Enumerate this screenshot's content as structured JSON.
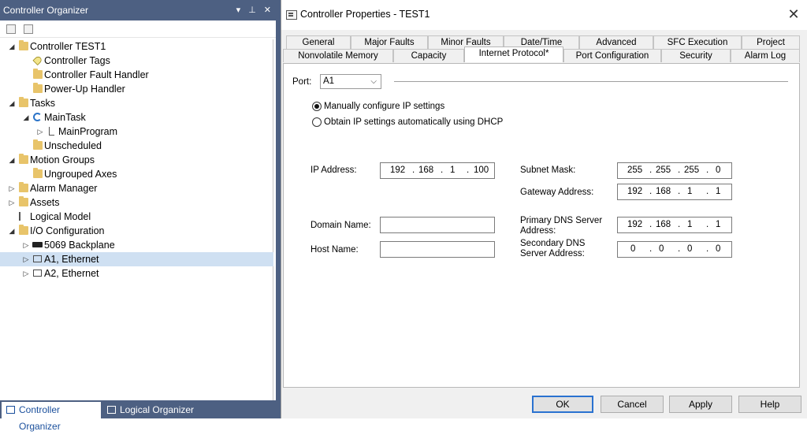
{
  "organizer": {
    "title": "Controller Organizer",
    "title_controls": [
      "▾",
      "⊥",
      "✕"
    ],
    "tree": [
      {
        "label": "Controller TEST1"
      },
      {
        "label": "Controller Tags"
      },
      {
        "label": "Controller Fault Handler"
      },
      {
        "label": "Power-Up Handler"
      },
      {
        "label": "Tasks"
      },
      {
        "label": "MainTask"
      },
      {
        "label": "MainProgram"
      },
      {
        "label": "Unscheduled"
      },
      {
        "label": "Motion Groups"
      },
      {
        "label": "Ungrouped Axes"
      },
      {
        "label": "Alarm Manager"
      },
      {
        "label": "Assets"
      },
      {
        "label": "Logical Model"
      },
      {
        "label": "I/O Configuration"
      },
      {
        "label": "5069 Backplane"
      },
      {
        "label": "A1, Ethernet"
      },
      {
        "label": "A2, Ethernet"
      }
    ],
    "bottom_tabs": [
      "Controller Organizer",
      "Logical Organizer"
    ]
  },
  "dialog": {
    "title": "Controller Properties - TEST1",
    "close": "✕",
    "tabs_row1": [
      "General",
      "Major Faults",
      "Minor Faults",
      "Date/Time",
      "Advanced",
      "SFC Execution",
      "Project"
    ],
    "tabs_row2": [
      "Nonvolatile Memory",
      "Capacity",
      "Internet Protocol*",
      "Port Configuration",
      "Security",
      "Alarm Log"
    ],
    "active_tab": "Internet Protocol*",
    "port": {
      "label": "Port:",
      "value": "A1",
      "chevron": "⌵"
    },
    "radios": [
      {
        "label": "Manually configure IP settings",
        "checked": true
      },
      {
        "label": "Obtain IP settings automatically using DHCP",
        "checked": false
      }
    ],
    "fields": {
      "ip_address": {
        "label": "IP Address:",
        "octets": [
          "192",
          "168",
          "1",
          "100"
        ]
      },
      "subnet_mask": {
        "label": "Subnet Mask:",
        "octets": [
          "255",
          "255",
          "255",
          "0"
        ]
      },
      "gateway": {
        "label": "Gateway Address:",
        "octets": [
          "192",
          "168",
          "1",
          "1"
        ]
      },
      "domain_name": {
        "label": "Domain Name:",
        "value": ""
      },
      "host_name": {
        "label": "Host Name:",
        "value": ""
      },
      "primary_dns": {
        "label": "Primary DNS Server Address:",
        "octets": [
          "192",
          "168",
          "1",
          "1"
        ]
      },
      "secondary_dns": {
        "label": "Secondary DNS Server Address:",
        "octets": [
          "0",
          "0",
          "0",
          "0"
        ]
      }
    },
    "buttons": {
      "ok": "OK",
      "cancel": "Cancel",
      "apply": "Apply",
      "help": "Help"
    }
  }
}
